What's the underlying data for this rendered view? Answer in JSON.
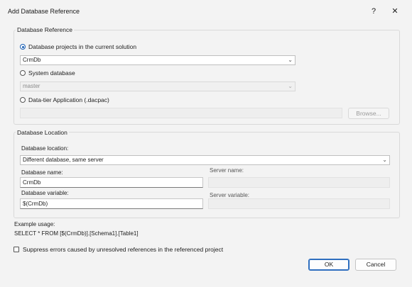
{
  "window": {
    "title": "Add Database Reference",
    "help": "?",
    "close": "✕"
  },
  "reference": {
    "legend": "Database Reference",
    "opt_projects": "Database projects in the current solution",
    "projects_value": "CrmDb",
    "opt_system": "System database",
    "system_value": "master",
    "opt_dacpac": "Data-tier Application (.dacpac)",
    "browse_label": "Browse..."
  },
  "location": {
    "legend": "Database Location",
    "location_label": "Database location:",
    "location_value": "Different database, same server",
    "db_name_label": "Database name:",
    "db_name_value": "CrmDb",
    "server_name_label": "Server name:",
    "db_var_label": "Database variable:",
    "db_var_value": "$(CrmDb)",
    "server_var_label": "Server variable:"
  },
  "example": {
    "label": "Example usage:",
    "text": "SELECT * FROM [$(CrmDb)].[Schema1].[Table1]"
  },
  "suppress_label": "Suppress errors caused by unresolved references in the referenced project",
  "buttons": {
    "ok": "OK",
    "cancel": "Cancel"
  }
}
